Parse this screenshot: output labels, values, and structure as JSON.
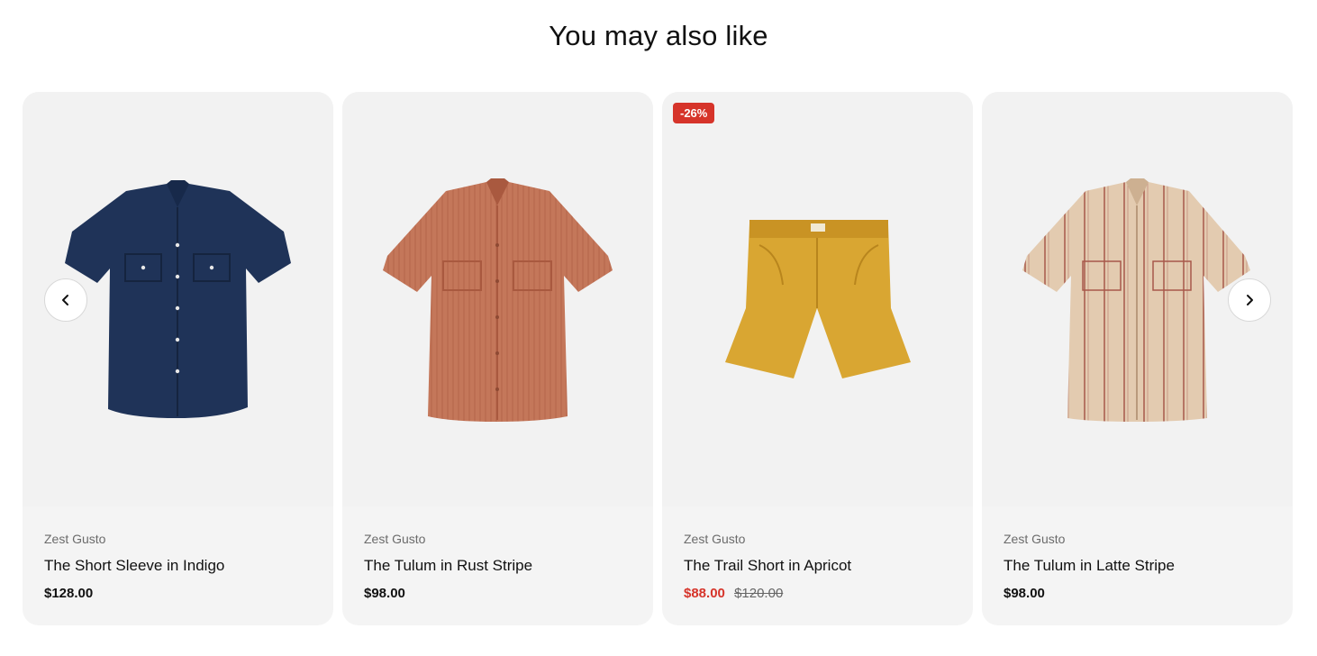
{
  "section": {
    "title": "You may also like"
  },
  "carousel": {
    "prev_icon": "chevron-left-icon",
    "next_icon": "chevron-right-icon"
  },
  "products": [
    {
      "vendor": "Zest Gusto",
      "title": "The Short Sleeve in Indigo",
      "price": "$128.00",
      "compare_price": "",
      "badge": "",
      "image": "navy-short-sleeve-shirt",
      "color": "#1f3358"
    },
    {
      "vendor": "Zest Gusto",
      "title": "The Tulum in Rust Stripe",
      "price": "$98.00",
      "compare_price": "",
      "badge": "",
      "image": "rust-striped-short-sleeve-shirt",
      "color": "#c4775a"
    },
    {
      "vendor": "Zest Gusto",
      "title": "The Trail Short in Apricot",
      "price": "$88.00",
      "compare_price": "$120.00",
      "badge": "-26%",
      "image": "apricot-shorts",
      "color": "#d9a632"
    },
    {
      "vendor": "Zest Gusto",
      "title": "The Tulum in Latte Stripe",
      "price": "$98.00",
      "compare_price": "",
      "badge": "",
      "image": "latte-striped-short-sleeve-shirt",
      "color": "#e3cbb0"
    }
  ],
  "colors": {
    "sale": "#d6342a",
    "card_bg": "#f4f4f4",
    "stripe_rust": "#b5644a",
    "stripe_latte": "#a8584a"
  }
}
